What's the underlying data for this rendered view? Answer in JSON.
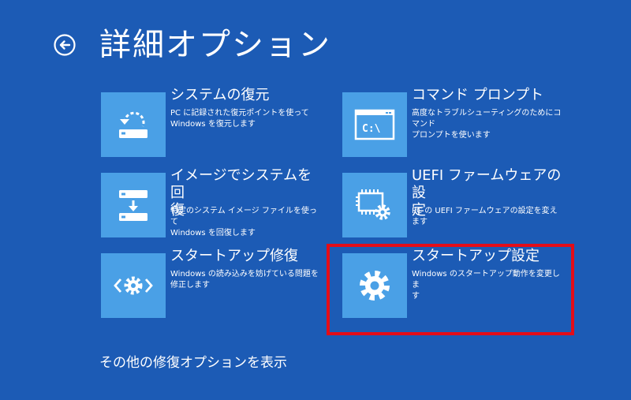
{
  "header": {
    "title": "詳細オプション",
    "back_icon": "back-arrow-icon"
  },
  "options": [
    {
      "title": "システムの復元",
      "desc1": "PC に記録された復元ポイントを使って",
      "desc2": "Windows を復元します",
      "icon": "system-restore-icon"
    },
    {
      "title": "コマンド プロンプト",
      "desc1": "高度なトラブルシューティングのためにコマンド",
      "desc2": "プロンプトを使います",
      "icon": "command-prompt-icon",
      "icon_text": "C:\\"
    },
    {
      "title1": "イメージでシステムを回",
      "title2": "復",
      "desc1": "特定のシステム イメージ ファイルを使って",
      "desc2": "Windows を回復します",
      "icon": "system-image-recovery-icon"
    },
    {
      "title1": "UEFI ファームウェアの設",
      "title2": "定",
      "desc1": "PC の UEFI ファームウェアの設定を変えます",
      "icon": "uefi-firmware-icon"
    },
    {
      "title": "スタートアップ修復",
      "desc1": "Windows の読み込みを妨げている問題を",
      "desc2": "修正します",
      "icon": "startup-repair-icon"
    },
    {
      "title": "スタートアップ設定",
      "desc1": "Windows のスタートアップ動作を変更しま",
      "desc2": "す",
      "icon": "gear-icon"
    }
  ],
  "footer": {
    "more_options": "その他の修復オプションを表示"
  },
  "colors": {
    "background": "#1c5bb5",
    "tile": "#4aa0e6",
    "highlight": "#e30d18",
    "text": "#ffffff"
  }
}
